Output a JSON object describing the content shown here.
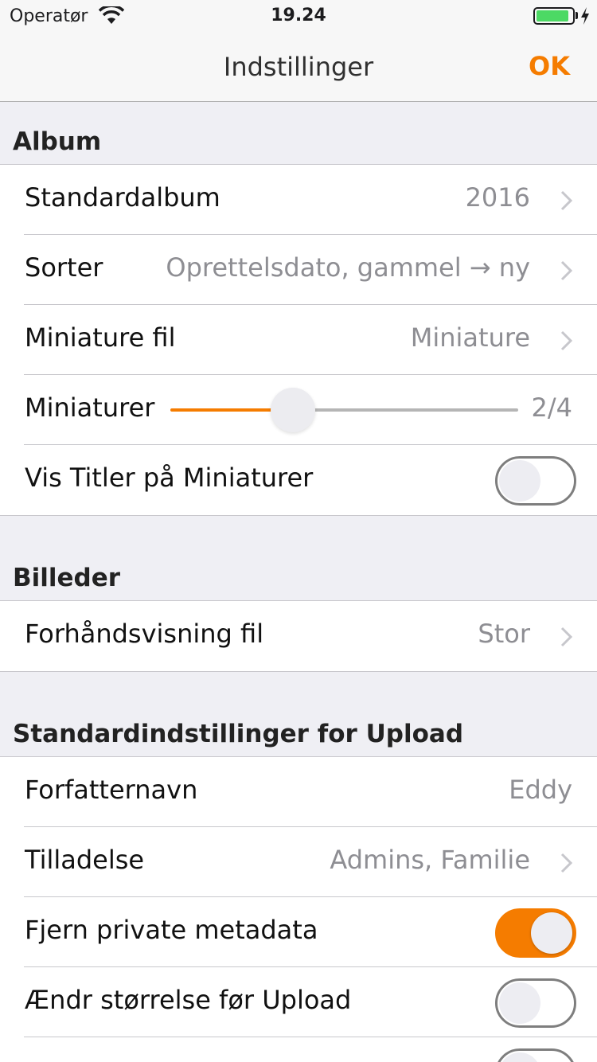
{
  "status_bar": {
    "carrier": "Operatør",
    "time": "19.24"
  },
  "nav": {
    "title": "Indstillinger",
    "ok": "OK"
  },
  "sections": {
    "album": {
      "header": "Album",
      "default_album": {
        "label": "Standardalbum",
        "value": "2016"
      },
      "sort": {
        "label": "Sorter",
        "value": "Oprettelsdato, gammel → ny"
      },
      "thumbnail_file": {
        "label": "Miniature fil",
        "value": "Miniature"
      },
      "thumbnails": {
        "label": "Miniaturer",
        "value": "2/4",
        "slider_fraction": 0.35
      },
      "show_titles": {
        "label": "Vis Titler på Miniaturer",
        "on": false
      }
    },
    "images": {
      "header": "Billeder",
      "preview_file": {
        "label": "Forhåndsvisning fil",
        "value": "Stor"
      }
    },
    "upload": {
      "header": "Standardindstillinger for Upload",
      "author": {
        "label": "Forfatternavn",
        "value": "Eddy"
      },
      "permission": {
        "label": "Tilladelse",
        "value": "Admins, Familie"
      },
      "strip_metadata": {
        "label": "Fjern private metadata",
        "on": true
      },
      "resize": {
        "label": "Ændr størrelse før Upload",
        "on": false
      }
    }
  },
  "colors": {
    "accent": "#f57c00",
    "background": "#efeff4",
    "secondary_text": "#8e8e93",
    "battery": "#4cd964"
  }
}
